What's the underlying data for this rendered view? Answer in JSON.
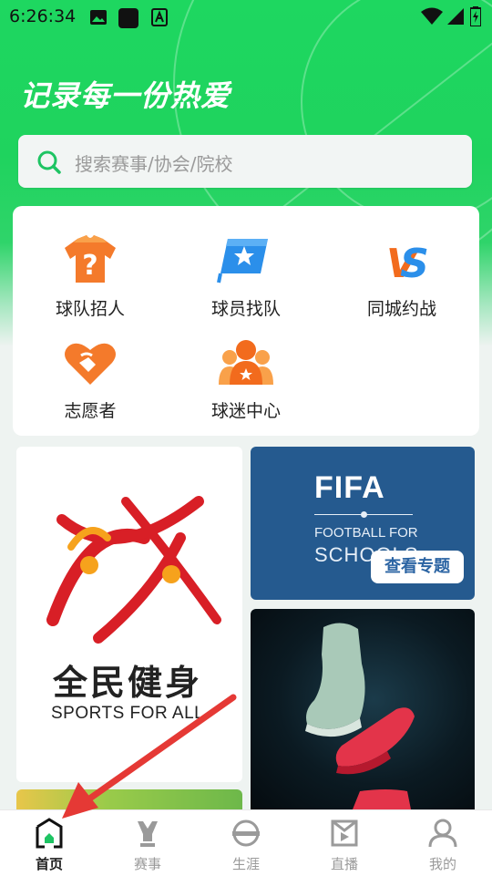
{
  "status_bar": {
    "time": "6:26:34"
  },
  "hero": {
    "tagline": "记录每一份热爱"
  },
  "search": {
    "placeholder": "搜索赛事/协会/院校"
  },
  "features": [
    {
      "label": "球队招人",
      "icon": "question-jersey-icon"
    },
    {
      "label": "球员找队",
      "icon": "star-flag-icon"
    },
    {
      "label": "同城约战",
      "icon": "vs-icon"
    },
    {
      "label": "志愿者",
      "icon": "heart-hands-icon"
    },
    {
      "label": "球迷中心",
      "icon": "fans-icon"
    }
  ],
  "banners": {
    "sports_for_all": {
      "cn": "全民健身",
      "en": "SPORTS FOR ALL"
    },
    "fifa": {
      "logo": "FIFA",
      "line1": "FOOTBALL FOR",
      "line2": "SCHOOLS",
      "button": "查看专题"
    }
  },
  "tabs": [
    {
      "label": "首页",
      "icon": "home-icon",
      "active": true
    },
    {
      "label": "赛事",
      "icon": "trophy-icon",
      "active": false
    },
    {
      "label": "生涯",
      "icon": "career-icon",
      "active": false
    },
    {
      "label": "直播",
      "icon": "live-icon",
      "active": false
    },
    {
      "label": "我的",
      "icon": "profile-icon",
      "active": false
    }
  ],
  "colors": {
    "brand_green": "#1ed760",
    "fifa_blue": "#255a8f",
    "accent_orange": "#f26b1d",
    "annotation_red": "#e53935"
  }
}
